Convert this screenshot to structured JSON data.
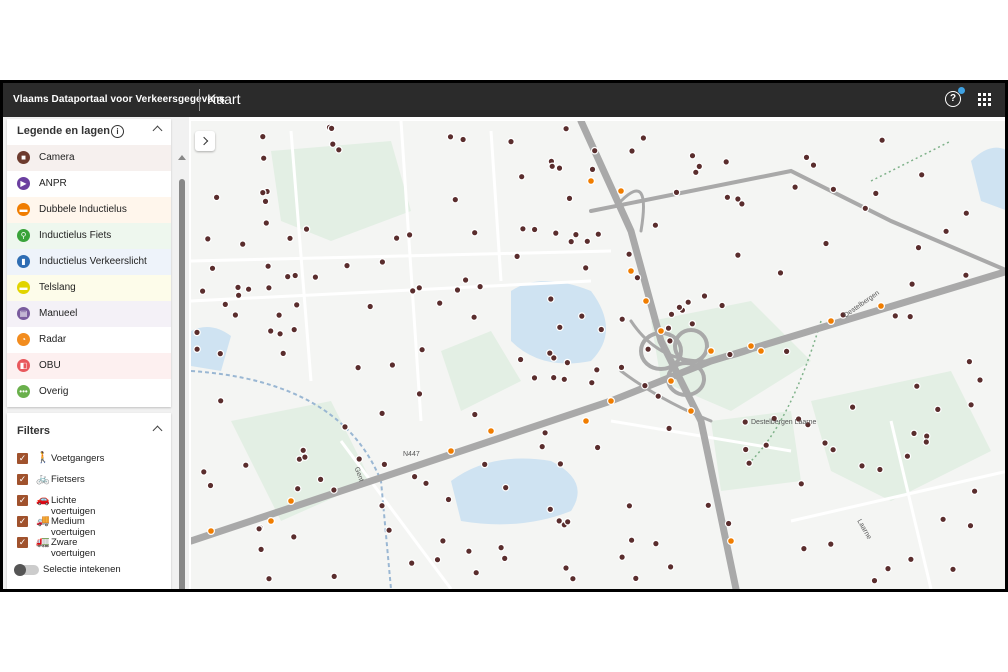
{
  "header": {
    "brand": "Vlaams Dataportaal voor Verkeersgegevens",
    "title": "Kaart"
  },
  "legend": {
    "title": "Legende en lagen",
    "items": [
      {
        "label": "Camera",
        "color": "#6d3b2e",
        "bg": "#f6f0ee",
        "icon": "camera-icon"
      },
      {
        "label": "ANPR",
        "color": "#6b3fa0",
        "bg": "#ffffff",
        "icon": "video-icon"
      },
      {
        "label": "Dubbele Inductielus",
        "color": "#f07d00",
        "bg": "#fff6ec",
        "icon": "dash-icon"
      },
      {
        "label": "Inductielus Fiets",
        "color": "#3aa33a",
        "bg": "#eef7ee",
        "icon": "bike-icon"
      },
      {
        "label": "Inductielus Verkeerslicht",
        "color": "#2f6db3",
        "bg": "#eef3fa",
        "icon": "traffic-light-icon"
      },
      {
        "label": "Telslang",
        "color": "#e1d400",
        "bg": "#fdfcea",
        "icon": "dash-icon"
      },
      {
        "label": "Manueel",
        "color": "#7a5c9e",
        "bg": "#f4f1f7",
        "icon": "clipboard-icon"
      },
      {
        "label": "Radar",
        "color": "#f28c1e",
        "bg": "#ffffff",
        "icon": "radar-icon"
      },
      {
        "label": "OBU",
        "color": "#e8585d",
        "bg": "#fdf0f0",
        "icon": "obu-icon"
      },
      {
        "label": "Overig",
        "color": "#6ab04c",
        "bg": "#ffffff",
        "icon": "dots-icon"
      }
    ]
  },
  "filters": {
    "title": "Filters",
    "items": [
      {
        "label": "Voetgangers",
        "icon": "🚶",
        "checked": true
      },
      {
        "label": "Fietsers",
        "icon": "🚲",
        "checked": true
      },
      {
        "label": "Lichte voertuigen",
        "icon": "🚗",
        "checked": true
      },
      {
        "label": "Medium voertuigen",
        "icon": "🚚",
        "checked": true
      },
      {
        "label": "Zware voertuigen",
        "icon": "🚛",
        "checked": true
      }
    ],
    "selection_label": "Selectie intekenen"
  },
  "map": {
    "road_labels": [
      "N447",
      "Destelbergen",
      "Destelbergen Laarne",
      "Laarne",
      "Gent"
    ],
    "colors": {
      "road": "#a9a9a9",
      "water": "#cfe3f2",
      "green": "#e3efe4",
      "camera": "#5a2d2d",
      "loop": "#f07d00"
    }
  }
}
